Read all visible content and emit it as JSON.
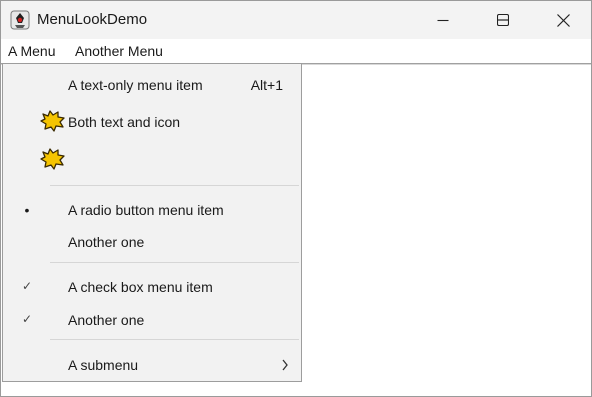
{
  "window": {
    "title": "MenuLookDemo",
    "app_icon": "java-duke-icon",
    "controls": [
      "minimize-icon",
      "maximize-icon",
      "close-icon"
    ]
  },
  "menubar": {
    "items": [
      {
        "label": "A Menu",
        "open": true
      },
      {
        "label": "Another Menu",
        "open": false
      }
    ]
  },
  "popup": {
    "items": [
      {
        "type": "item",
        "label": "A text-only menu item",
        "accelerator": "Alt+1"
      },
      {
        "type": "item",
        "label": "Both text and icon",
        "icon": "burst-star-icon"
      },
      {
        "type": "item",
        "label": "",
        "icon": "burst-star-icon"
      },
      {
        "type": "radio",
        "label": "A radio button menu item",
        "selected": true
      },
      {
        "type": "radio",
        "label": "Another one",
        "selected": false
      },
      {
        "type": "checkbox",
        "label": "A check box menu item",
        "checked": true
      },
      {
        "type": "checkbox",
        "label": "Another one",
        "checked": true
      },
      {
        "type": "submenu",
        "label": "A submenu"
      }
    ],
    "radio_mark": "•",
    "check_mark": "✓"
  },
  "colors": {
    "titlebar_bg": "#f3f3f3",
    "popup_bg": "#f2f2f2",
    "icon_fill": "#f5c400"
  }
}
